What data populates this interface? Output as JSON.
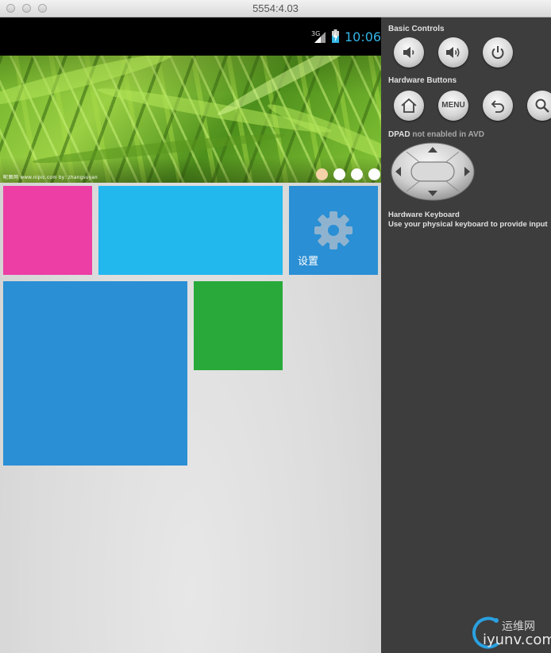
{
  "window": {
    "title": "5554:4.03"
  },
  "statusbar": {
    "network": "3G",
    "clock": "10:06",
    "clock_color": "#33b5e5"
  },
  "banner": {
    "caption": "昵图网 www.nipic.com  by: zhangsuyan",
    "page_count": 4,
    "active_page": 1
  },
  "tiles": {
    "settings_label": "设置",
    "colors": {
      "pink": "#ec3ea5",
      "cyan": "#22b8ed",
      "blue": "#2a8fd4",
      "green": "#29a93a"
    }
  },
  "panel": {
    "basic_controls": "Basic Controls",
    "hardware_buttons": "Hardware Buttons",
    "dpad_label": "DPAD",
    "dpad_note": "not enabled in AVD",
    "menu_label": "MENU",
    "keyboard_title": "Hardware Keyboard",
    "keyboard_note": "Use your physical keyboard to provide input"
  },
  "watermark": {
    "top": "运维网",
    "bottom": "iyunv.com"
  }
}
